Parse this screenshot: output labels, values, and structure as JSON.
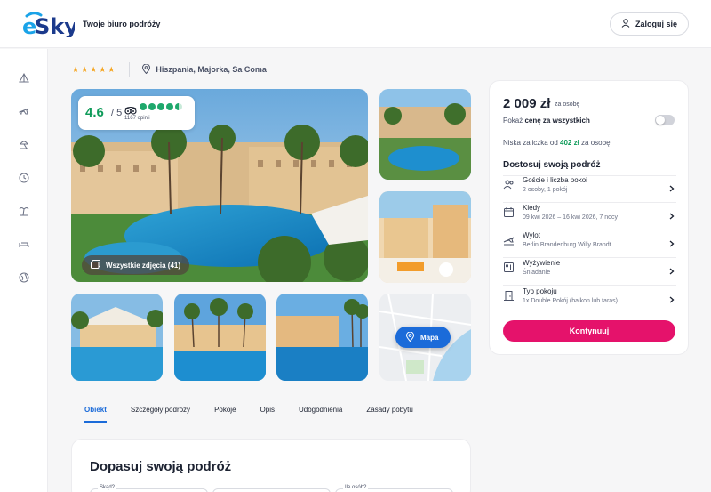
{
  "header": {
    "tagline": "Twoje biuro podróży",
    "login_label": "Zaloguj się"
  },
  "sidebar": {
    "items": [
      {
        "icon": "tent-icon"
      },
      {
        "icon": "plane-icon"
      },
      {
        "icon": "beach-icon"
      },
      {
        "icon": "clock-icon"
      },
      {
        "icon": "palm-icon"
      },
      {
        "icon": "bed-icon"
      },
      {
        "icon": "globe-icon"
      }
    ]
  },
  "hotel": {
    "stars": "★★★★★",
    "location": "Hiszpania, Majorka, Sa Coma"
  },
  "rating": {
    "score": "4.6",
    "max": "/ 5",
    "reviews": "1167 opinii",
    "bubbles": 4.5
  },
  "gallery": {
    "all_photos_label": "Wszystkie zdjęcia (41)",
    "map_label": "Mapa"
  },
  "tabs": [
    "Obiekt",
    "Szczegóły podróży",
    "Pokoje",
    "Opis",
    "Udogodnienia",
    "Zasady pobytu"
  ],
  "adjust": {
    "title": "Dopasuj swoją podróż",
    "fields": [
      "Skąd?",
      "",
      "Ile osób?"
    ]
  },
  "price_card": {
    "price": "2 009 zł",
    "per": "za osobę",
    "show_total_prefix": "Pokaż ",
    "show_total_bold": "cenę za wszystkich",
    "deposit_prefix": "Niska zaliczka od ",
    "deposit_amount": "402 zł",
    "deposit_suffix": " za osobę",
    "section_title": "Dostosuj swoją podróż",
    "options": [
      {
        "title": "Goście i liczba pokoi",
        "sub": "2 osoby, 1 pokój",
        "icon": "guests-icon"
      },
      {
        "title": "Kiedy",
        "sub": "09 kwi 2026 – 16 kwi 2026, 7 nocy",
        "icon": "calendar-icon"
      },
      {
        "title": "Wylot",
        "sub": "Berlin Brandenburg Willy Brandt",
        "icon": "plane-takeoff-icon"
      },
      {
        "title": "Wyżywienie",
        "sub": "Śniadanie",
        "icon": "meal-icon"
      },
      {
        "title": "Typ pokoju",
        "sub": "1x Double Pokój (balkon lub taras)",
        "icon": "door-icon"
      }
    ],
    "cta_label": "Kontynuuj"
  },
  "colors": {
    "brand_pink": "#e5126b",
    "brand_blue": "#1b6bd9",
    "rating_green": "#0f9b5a",
    "star_orange": "#f5a623"
  }
}
